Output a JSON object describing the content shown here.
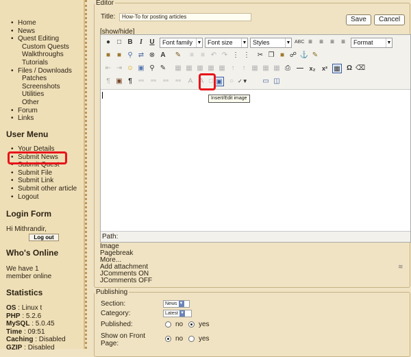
{
  "nav": {
    "items": [
      {
        "label": "Home",
        "sub": false
      },
      {
        "label": "News",
        "sub": false
      },
      {
        "label": "Quest Editing",
        "sub": false
      },
      {
        "label": "Custom Quests",
        "sub": true
      },
      {
        "label": "Walkthroughs",
        "sub": true
      },
      {
        "label": "Tutorials",
        "sub": true
      },
      {
        "label": "Files / Downloads",
        "sub": false
      },
      {
        "label": "Patches",
        "sub": true
      },
      {
        "label": "Screenshots",
        "sub": true
      },
      {
        "label": "Utilities",
        "sub": true
      },
      {
        "label": "Other",
        "sub": true
      },
      {
        "label": "Forum",
        "sub": false
      },
      {
        "label": "Links",
        "sub": false
      }
    ]
  },
  "user_menu": {
    "title": "User Menu",
    "items": [
      "Your Details",
      "Submit News",
      "Submit Quest",
      "Submit File",
      "Submit Link",
      "Submit other article",
      "Logout"
    ]
  },
  "login_form": {
    "title": "Login Form",
    "greeting": "Hi Mithrandir,",
    "logout_label": "Log out"
  },
  "whos_online": {
    "title": "Who's Online",
    "line1": "We have 1",
    "line2": "member online"
  },
  "statistics": {
    "title": "Statistics",
    "rows": [
      {
        "key": "OS",
        "value": "Linux t"
      },
      {
        "key": "PHP",
        "value": "5.2.6"
      },
      {
        "key": "MySQL",
        "value": "5.0.45"
      },
      {
        "key": "Time",
        "value": "09:51"
      },
      {
        "key": "Caching",
        "value": "Disabled"
      },
      {
        "key": "GZIP",
        "value": "Disabled"
      }
    ]
  },
  "editor": {
    "legend": "Editor",
    "title_label": "Title:",
    "title_value": "How-To for posting articles",
    "save_label": "Save",
    "cancel_label": "Cancel",
    "show_hide": "[show/hide]",
    "selects": {
      "font_family": "Font family",
      "font_size": "Font size",
      "styles": "Styles",
      "format": "Format"
    },
    "tooltip": "Insert/Edit image",
    "path_label": "Path:",
    "below_links": [
      "Image",
      "Pagebreak",
      "More...",
      "Add attachment",
      "JComments ON",
      "JComments OFF"
    ]
  },
  "publishing": {
    "legend": "Publishing",
    "section_label": "Section:",
    "section_value": "News",
    "category_label": "Category:",
    "category_value": "Latest",
    "published_label": "Published:",
    "published_value": "yes",
    "frontpage_label_1": "Show on Front",
    "frontpage_label_2": "Page:",
    "frontpage_value": "no",
    "no_label": "no",
    "yes_label": "yes"
  },
  "colors": {
    "page_bg": "#f0e3c3",
    "highlight": "#e8141a"
  }
}
